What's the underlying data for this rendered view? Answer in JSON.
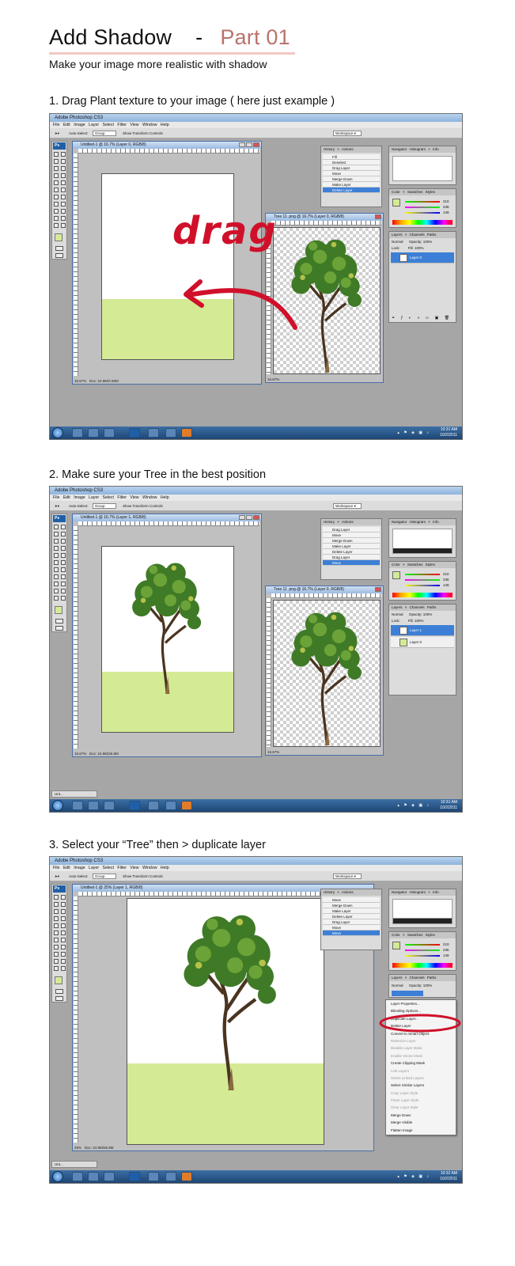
{
  "header": {
    "title_main": "Add Shadow",
    "title_dash": "-",
    "title_part": "Part 01",
    "subtitle": "Make your image more realistic with shadow"
  },
  "steps": [
    {
      "label": "1. Drag Plant texture to your image ( here just example )"
    },
    {
      "label": "2. Make sure your Tree in the best position"
    },
    {
      "label": "3. Select your “Tree”  then > duplicate layer"
    }
  ],
  "app": {
    "title": "Adobe Photoshop CS3",
    "menu": [
      "File",
      "Edit",
      "Image",
      "Layer",
      "Select",
      "Filter",
      "View",
      "Window",
      "Help"
    ],
    "options": {
      "auto_select": "Auto-Select:",
      "group_value": "Group",
      "transform": "Show Transform Controls",
      "workspace": "Workspace ▾"
    },
    "toolbox_logo": "Ps"
  },
  "screens": [
    {
      "doc_title": "Untitled-1 @ 16.7% (Layer 0, RGB/8)",
      "doc_zoom": "16.67%",
      "doc_status": "Doc: 24.9M/2.60M",
      "tree_title": "Tree 11 .png @ 16.7% (Layer 0, RGB/8)",
      "tree_zoom": "16.67%",
      "annotation": "drag",
      "history_tabs": "History ×  Actions",
      "history": [
        "Fill",
        "Deselect",
        "Drag Layer",
        "Move",
        "Merge Down",
        "Make Layer",
        "Delete Layer"
      ],
      "history_selected": 6,
      "nav_tabs": "Navigator  Histogram ×  Info",
      "color_tabs": "Color ×  Swatches  Styles",
      "color_values": [
        "210",
        "236",
        "149"
      ],
      "layers_tabs": "Layers ×  Channels  Paths",
      "blend": "Normal",
      "opacity": "Opacity: 100%",
      "lock": "Lock:",
      "fill": "Fill: 100%",
      "layers": [
        {
          "name": "Layer 0",
          "selected": true
        }
      ],
      "clock_time": "10:31 AM",
      "clock_date": "10/2/2011"
    },
    {
      "doc_title": "Untitled-1 @ 16.7% (Layer 1, RGB/8)",
      "doc_zoom": "16.67%",
      "doc_status": "Doc: 24.9M/26.9M",
      "tree_title": "Tree 11 .png @ 16.7% (Layer 0, RGB/8)",
      "tree_zoom": "16.67%",
      "history_tabs": "History ×  Actions",
      "history": [
        "Drag Layer",
        "Move",
        "Merge Down",
        "Make Layer",
        "Delete Layer",
        "Drag Layer",
        "Move"
      ],
      "history_selected": 6,
      "nav_tabs": "Navigator  Histogram ×  Info",
      "color_tabs": "Color ×  Swatches  Styles",
      "color_values": [
        "210",
        "236",
        "149"
      ],
      "layers_tabs": "Layers ×  Channels  Paths",
      "blend": "Normal",
      "opacity": "Opacity: 100%",
      "lock": "Lock:",
      "fill": "Fill: 100%",
      "layers": [
        {
          "name": "Layer 1",
          "selected": true
        },
        {
          "name": "Layer 0",
          "selected": false
        }
      ],
      "mini_task": "Unt...",
      "clock_time": "10:31 AM",
      "clock_date": "10/2/2011"
    },
    {
      "doc_title": "Untitled-1 @ 25% (Layer 1, RGB/8)",
      "doc_zoom": "25%",
      "doc_status": "Doc: 24.9M/26.9M",
      "history_tabs": "History ×  Actions",
      "history": [
        "Move",
        "Merge Down",
        "Make Layer",
        "Delete Layer",
        "Drag Layer",
        "Move",
        "Move"
      ],
      "history_selected": 6,
      "nav_tabs": "Navigator  Histogram ×  Info",
      "color_tabs": "Color ×  Swatches  Styles",
      "color_values": [
        "210",
        "236",
        "149"
      ],
      "layers_tabs": "Layers ×  Channels  Paths",
      "blend": "Normal",
      "opacity": "Opacity: 100%",
      "context_menu": [
        {
          "label": "Layer Properties...",
          "disabled": false
        },
        {
          "label": "Blending Options...",
          "disabled": false
        },
        {
          "label": "Duplicate Layer...",
          "disabled": false
        },
        {
          "label": "Delete Layer",
          "disabled": false
        },
        {
          "label": "Convert to Smart Object",
          "disabled": false
        },
        {
          "label": "Rasterize Layer",
          "disabled": true
        },
        {
          "label": "Disable Layer Mask",
          "disabled": true
        },
        {
          "label": "Enable Vector Mask",
          "disabled": true
        },
        {
          "label": "Create Clipping Mask",
          "disabled": false
        },
        {
          "label": "Link Layers",
          "disabled": true
        },
        {
          "label": "Select Linked Layers",
          "disabled": true
        },
        {
          "label": "Select Similar Layers",
          "disabled": false
        },
        {
          "label": "Copy Layer Style",
          "disabled": true
        },
        {
          "label": "Paste Layer Style",
          "disabled": true
        },
        {
          "label": "Clear Layer Style",
          "disabled": true
        },
        {
          "label": "Merge Down",
          "disabled": false
        },
        {
          "label": "Merge Visible",
          "disabled": false
        },
        {
          "label": "Flatten Image",
          "disabled": false
        }
      ],
      "mini_task": "Unt...",
      "clock_time": "10:32 AM",
      "clock_date": "10/2/2011"
    }
  ],
  "colors": {
    "accent_title": "#b9726c",
    "grass": "#d4ea95",
    "annotation": "#d0102a",
    "selection": "#3d7fd6"
  }
}
